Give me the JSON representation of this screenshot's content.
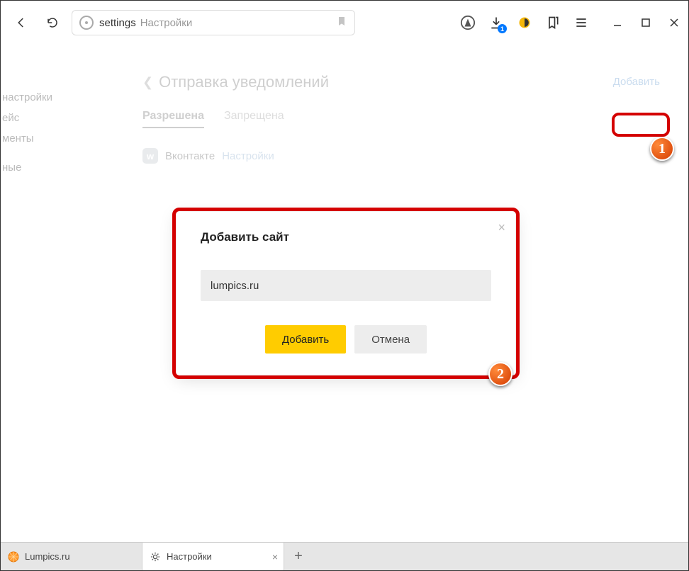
{
  "toolbar": {
    "address_prefix": "settings",
    "address_label": "Настройки",
    "downloads_badge": "1"
  },
  "sidebar": {
    "items": [
      "настройки",
      "ейс",
      "менты",
      "",
      "ные"
    ]
  },
  "page": {
    "title": "Отправка уведомлений",
    "add_link": "Добавить",
    "tabs": {
      "allowed": "Разрешена",
      "denied": "Запрещена"
    },
    "site": {
      "name": "Вконтакте",
      "settings_link": "Настройки"
    }
  },
  "modal": {
    "title": "Добавить сайт",
    "input_value": "lumpics.ru",
    "submit": "Добавить",
    "cancel": "Отмена"
  },
  "tabs": {
    "tab1": "Lumpics.ru",
    "tab2": "Настройки"
  },
  "callouts": {
    "one": "1",
    "two": "2"
  }
}
